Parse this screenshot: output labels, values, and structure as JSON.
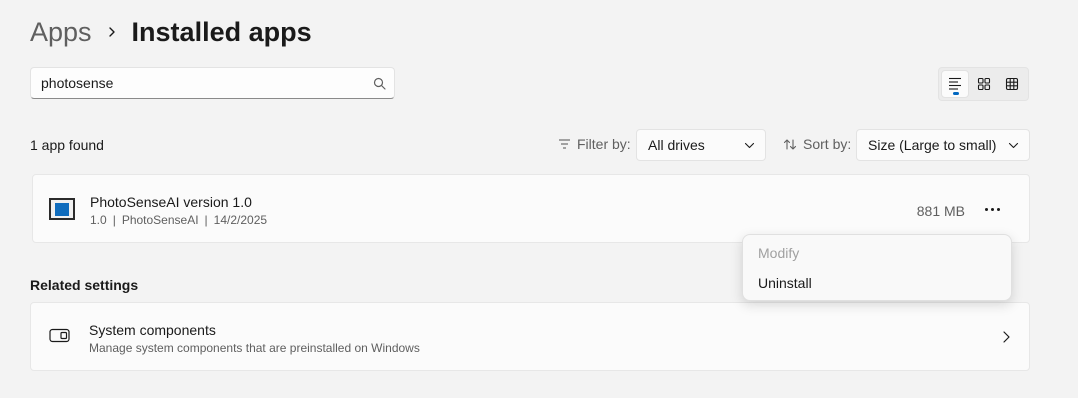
{
  "breadcrumb": {
    "parent": "Apps",
    "current": "Installed apps"
  },
  "search": {
    "value": "photosense",
    "placeholder": ""
  },
  "results": {
    "count_text": "1 app found"
  },
  "filter": {
    "label": "Filter by:",
    "selected": "All drives"
  },
  "sort": {
    "label": "Sort by:",
    "selected": "Size (Large to small)"
  },
  "view_toggle": {
    "active": "list",
    "options": [
      "list",
      "tiles",
      "grid"
    ]
  },
  "app": {
    "name": "PhotoSenseAI version 1.0",
    "version": "1.0",
    "sep1": "|",
    "publisher": "PhotoSenseAI",
    "sep2": "|",
    "date": "14/2/2025",
    "size": "881 MB"
  },
  "context_menu": {
    "items": [
      {
        "label": "Modify",
        "enabled": false
      },
      {
        "label": "Uninstall",
        "enabled": true
      }
    ]
  },
  "related": {
    "title": "Related settings",
    "system_components": {
      "title": "System components",
      "description": "Manage system components that are preinstalled on Windows"
    }
  },
  "colors": {
    "accent": "#0067c0",
    "app_icon_blue": "#0f6cbd",
    "background": "#f3f3f3"
  }
}
